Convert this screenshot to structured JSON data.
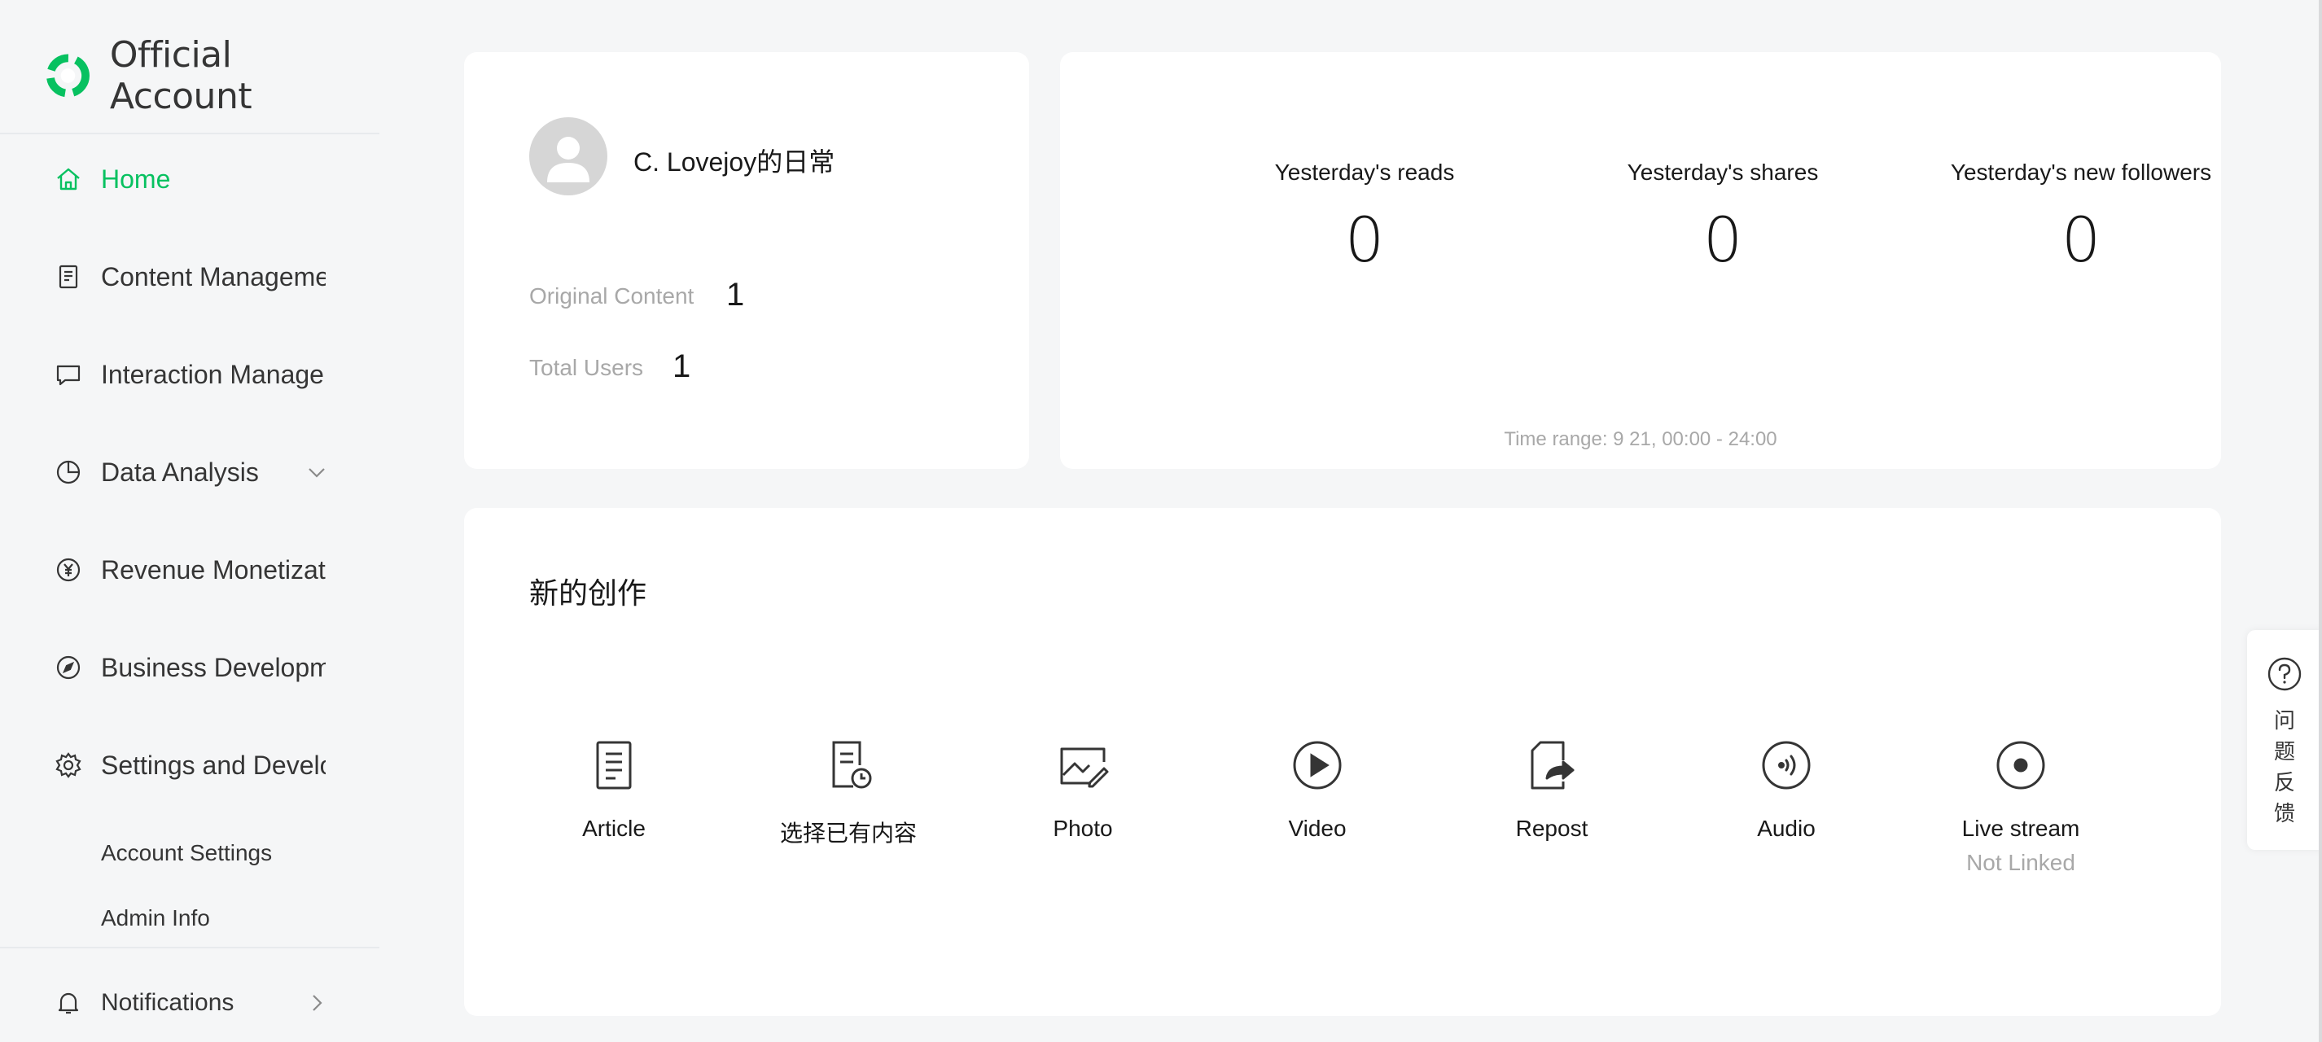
{
  "brand": {
    "name": "Official Account",
    "accent_color": "#07c160"
  },
  "sidebar": {
    "items": [
      {
        "label": "Home",
        "icon": "home-icon",
        "active": true
      },
      {
        "label": "Content Management",
        "icon": "document-icon"
      },
      {
        "label": "Interaction Management",
        "icon": "message-icon"
      },
      {
        "label": "Data Analysis",
        "icon": "pie-chart-icon",
        "expand": "chevron-down-icon"
      },
      {
        "label": "Revenue Monetization",
        "icon": "yuan-icon"
      },
      {
        "label": "Business Development",
        "icon": "compass-icon"
      },
      {
        "label": "Settings and Development",
        "icon": "gear-icon"
      }
    ],
    "sub_items": [
      "Account Settings",
      "Admin Info"
    ],
    "notifications": {
      "label": "Notifications",
      "icon": "bell-icon"
    }
  },
  "profile": {
    "name": "C. Lovejoy的日常",
    "original_content_label": "Original Content",
    "original_content_value": "1",
    "total_users_label": "Total Users",
    "total_users_value": "1"
  },
  "stats": {
    "metrics": [
      {
        "label": "Yesterday's reads",
        "value": "0"
      },
      {
        "label": "Yesterday's shares",
        "value": "0"
      },
      {
        "label": "Yesterday's new followers",
        "value": "0"
      }
    ],
    "time_range": "Time range: 9 21, 00:00 - 24:00"
  },
  "create": {
    "title": "新的创作",
    "tools": [
      {
        "label": "Article",
        "icon": "article-icon"
      },
      {
        "label": "选择已有内容",
        "icon": "existing-content-icon"
      },
      {
        "label": "Photo",
        "icon": "photo-icon"
      },
      {
        "label": "Video",
        "icon": "video-icon"
      },
      {
        "label": "Repost",
        "icon": "repost-icon"
      },
      {
        "label": "Audio",
        "icon": "audio-icon"
      },
      {
        "label": "Live stream",
        "icon": "live-stream-icon",
        "sub": "Not Linked"
      }
    ]
  },
  "feedback": {
    "label": "问题反馈",
    "chars": [
      "问",
      "题",
      "反",
      "馈"
    ],
    "icon": "question-icon"
  }
}
